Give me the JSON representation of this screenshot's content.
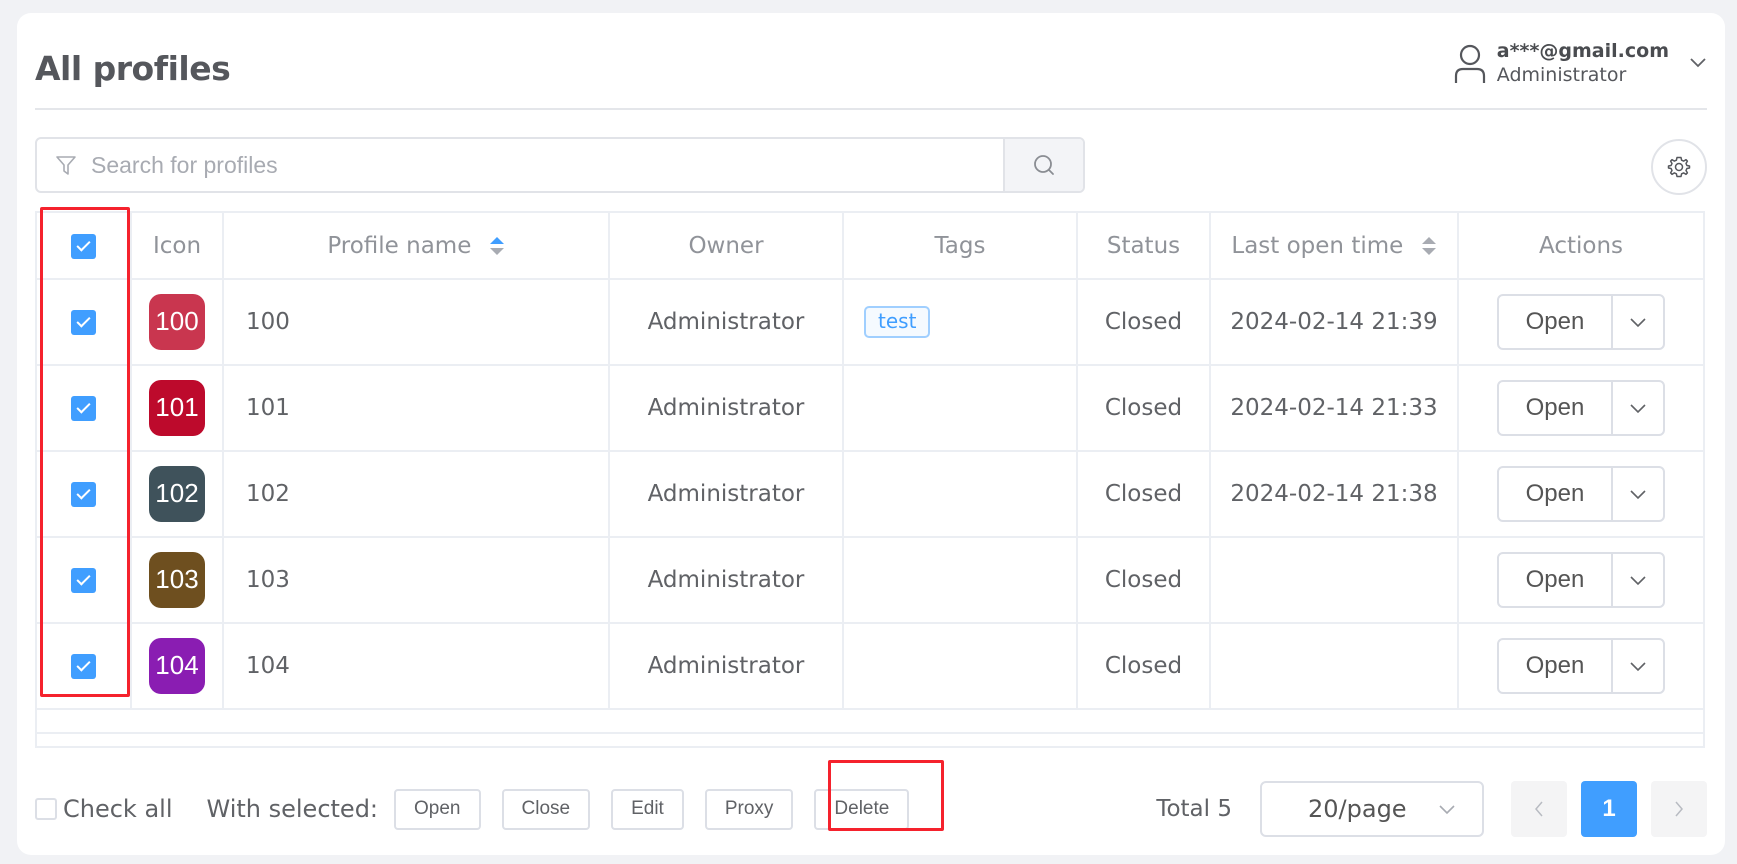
{
  "header": {
    "title": "All profiles",
    "user_email": "a***@gmail.com",
    "user_role": "Administrator"
  },
  "search": {
    "placeholder": "Search for profiles",
    "value": ""
  },
  "table": {
    "columns": [
      "Icon",
      "Profile name",
      "Owner",
      "Tags",
      "Status",
      "Last open time",
      "Actions"
    ],
    "rows": [
      {
        "icon_label": "100",
        "icon_color": "#c9364f",
        "name": "100",
        "owner": "Administrator",
        "tag": "test",
        "status": "Closed",
        "last_open": "2024-02-14 21:39",
        "action": "Open",
        "checked": true
      },
      {
        "icon_label": "101",
        "icon_color": "#bd0a2c",
        "name": "101",
        "owner": "Administrator",
        "tag": "",
        "status": "Closed",
        "last_open": "2024-02-14 21:33",
        "action": "Open",
        "checked": true
      },
      {
        "icon_label": "102",
        "icon_color": "#3f525b",
        "name": "102",
        "owner": "Administrator",
        "tag": "",
        "status": "Closed",
        "last_open": "2024-02-14 21:38",
        "action": "Open",
        "checked": true
      },
      {
        "icon_label": "103",
        "icon_color": "#6e4f1f",
        "name": "103",
        "owner": "Administrator",
        "tag": "",
        "status": "Closed",
        "last_open": "",
        "action": "Open",
        "checked": true
      },
      {
        "icon_label": "104",
        "icon_color": "#8a1db2",
        "name": "104",
        "owner": "Administrator",
        "tag": "",
        "status": "Closed",
        "last_open": "",
        "action": "Open",
        "checked": true
      }
    ]
  },
  "footer": {
    "check_all_label": "Check all",
    "with_selected_label": "With selected:",
    "bulk_actions": [
      "Open",
      "Close",
      "Edit",
      "Proxy",
      "Delete"
    ],
    "total_label": "Total 5",
    "page_size": "20/page",
    "current_page": "1"
  },
  "colors": {
    "accent": "#409eff",
    "highlight": "#f5222d"
  }
}
